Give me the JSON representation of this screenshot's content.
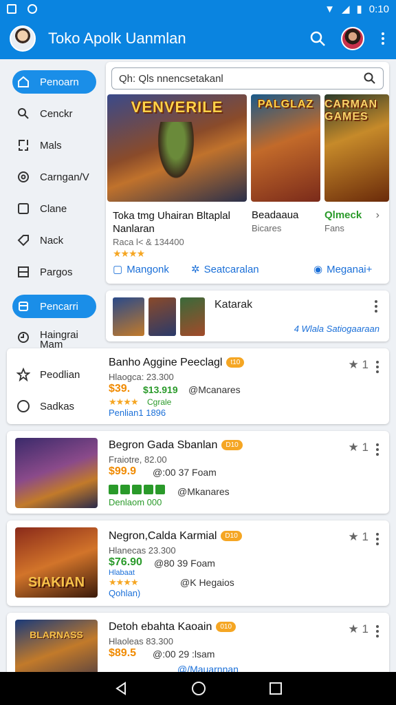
{
  "status": {
    "time": "0:10"
  },
  "app": {
    "title": "Toko Apolk Uanmlan"
  },
  "sidebar": {
    "items": [
      {
        "label": "Penoarn",
        "active": true
      },
      {
        "label": "Cenckr"
      },
      {
        "label": "Mals"
      },
      {
        "label": "Carngan/V"
      },
      {
        "label": "Clane"
      },
      {
        "label": "Nack"
      },
      {
        "label": "Pargos"
      },
      {
        "label": "Pencarri",
        "active": true
      },
      {
        "label": "Haingrai Mam"
      },
      {
        "label": "Peodlian"
      },
      {
        "label": "Sadkas"
      }
    ]
  },
  "search": {
    "placeholder": "Qh: Qls nnencsetakanl"
  },
  "featured": {
    "banners": [
      {
        "art": "VENVERILE",
        "name": "Toka tmg Uhairan Bltaplal Nanlaran",
        "sub": "Raca l< & 134400",
        "rating": "★★★★"
      },
      {
        "art": "PALGLAZ",
        "name": "Beadaaua",
        "sub": "Bicares"
      },
      {
        "art": "CARMAN GAMES",
        "name": "Qlmeck",
        "sub": "Fans"
      }
    ],
    "links": [
      "Mangonk",
      "Seatcaralan",
      "Meganai+"
    ]
  },
  "katarak": {
    "title": "Katarak",
    "link": "4 Wlala Satiogaaraan"
  },
  "products": [
    {
      "name": "Banho Aggine Peeclagl",
      "badge": "t10",
      "sub": "Hlaogca: 23.300",
      "price": "$39.",
      "price2": "$13.919",
      "tag": "@Mcanares",
      "stars": "★★★★",
      "extra": "Cgrale",
      "footer": "Penlian1 1896",
      "rating": "1"
    },
    {
      "name": "Begron Gada Sbanlan",
      "badge": "D10",
      "sub": "Fraiotre, 82.00",
      "price": "$99.9",
      "price2": "@:00 37 Foam",
      "tag": "@Mkanares",
      "extra": "",
      "footer": "Denlaom 000",
      "rating": "1"
    },
    {
      "name": "Negron,Calda Karmial",
      "badge": "D10",
      "sub": "Hlanecas 23.300",
      "price": "$76.90",
      "price2": "@80 39 Foam",
      "tag": "@K Hegaios",
      "stars": "★★★★",
      "extra": "Hlabaat",
      "footer": "Qohlan)",
      "rating": "1"
    },
    {
      "name": "Detoh ebahta Kaoain",
      "badge": "010",
      "sub": "Hlaoleas 83.300",
      "price": "$89.5",
      "price2": "@:00 29 :lsam",
      "tag": "@/Mauarnnan",
      "rating": "1"
    }
  ],
  "colors": {
    "primary": "#0a84e0",
    "accent": "#f08a00",
    "link": "#1a6fd8",
    "green": "#2a9a2a"
  },
  "icons": [
    "gallery-icon",
    "notification-icon",
    "wifi-icon",
    "signal-icon",
    "battery-icon",
    "search-icon",
    "more-icon",
    "back-icon",
    "home-icon",
    "recents-icon",
    "star-icon"
  ]
}
